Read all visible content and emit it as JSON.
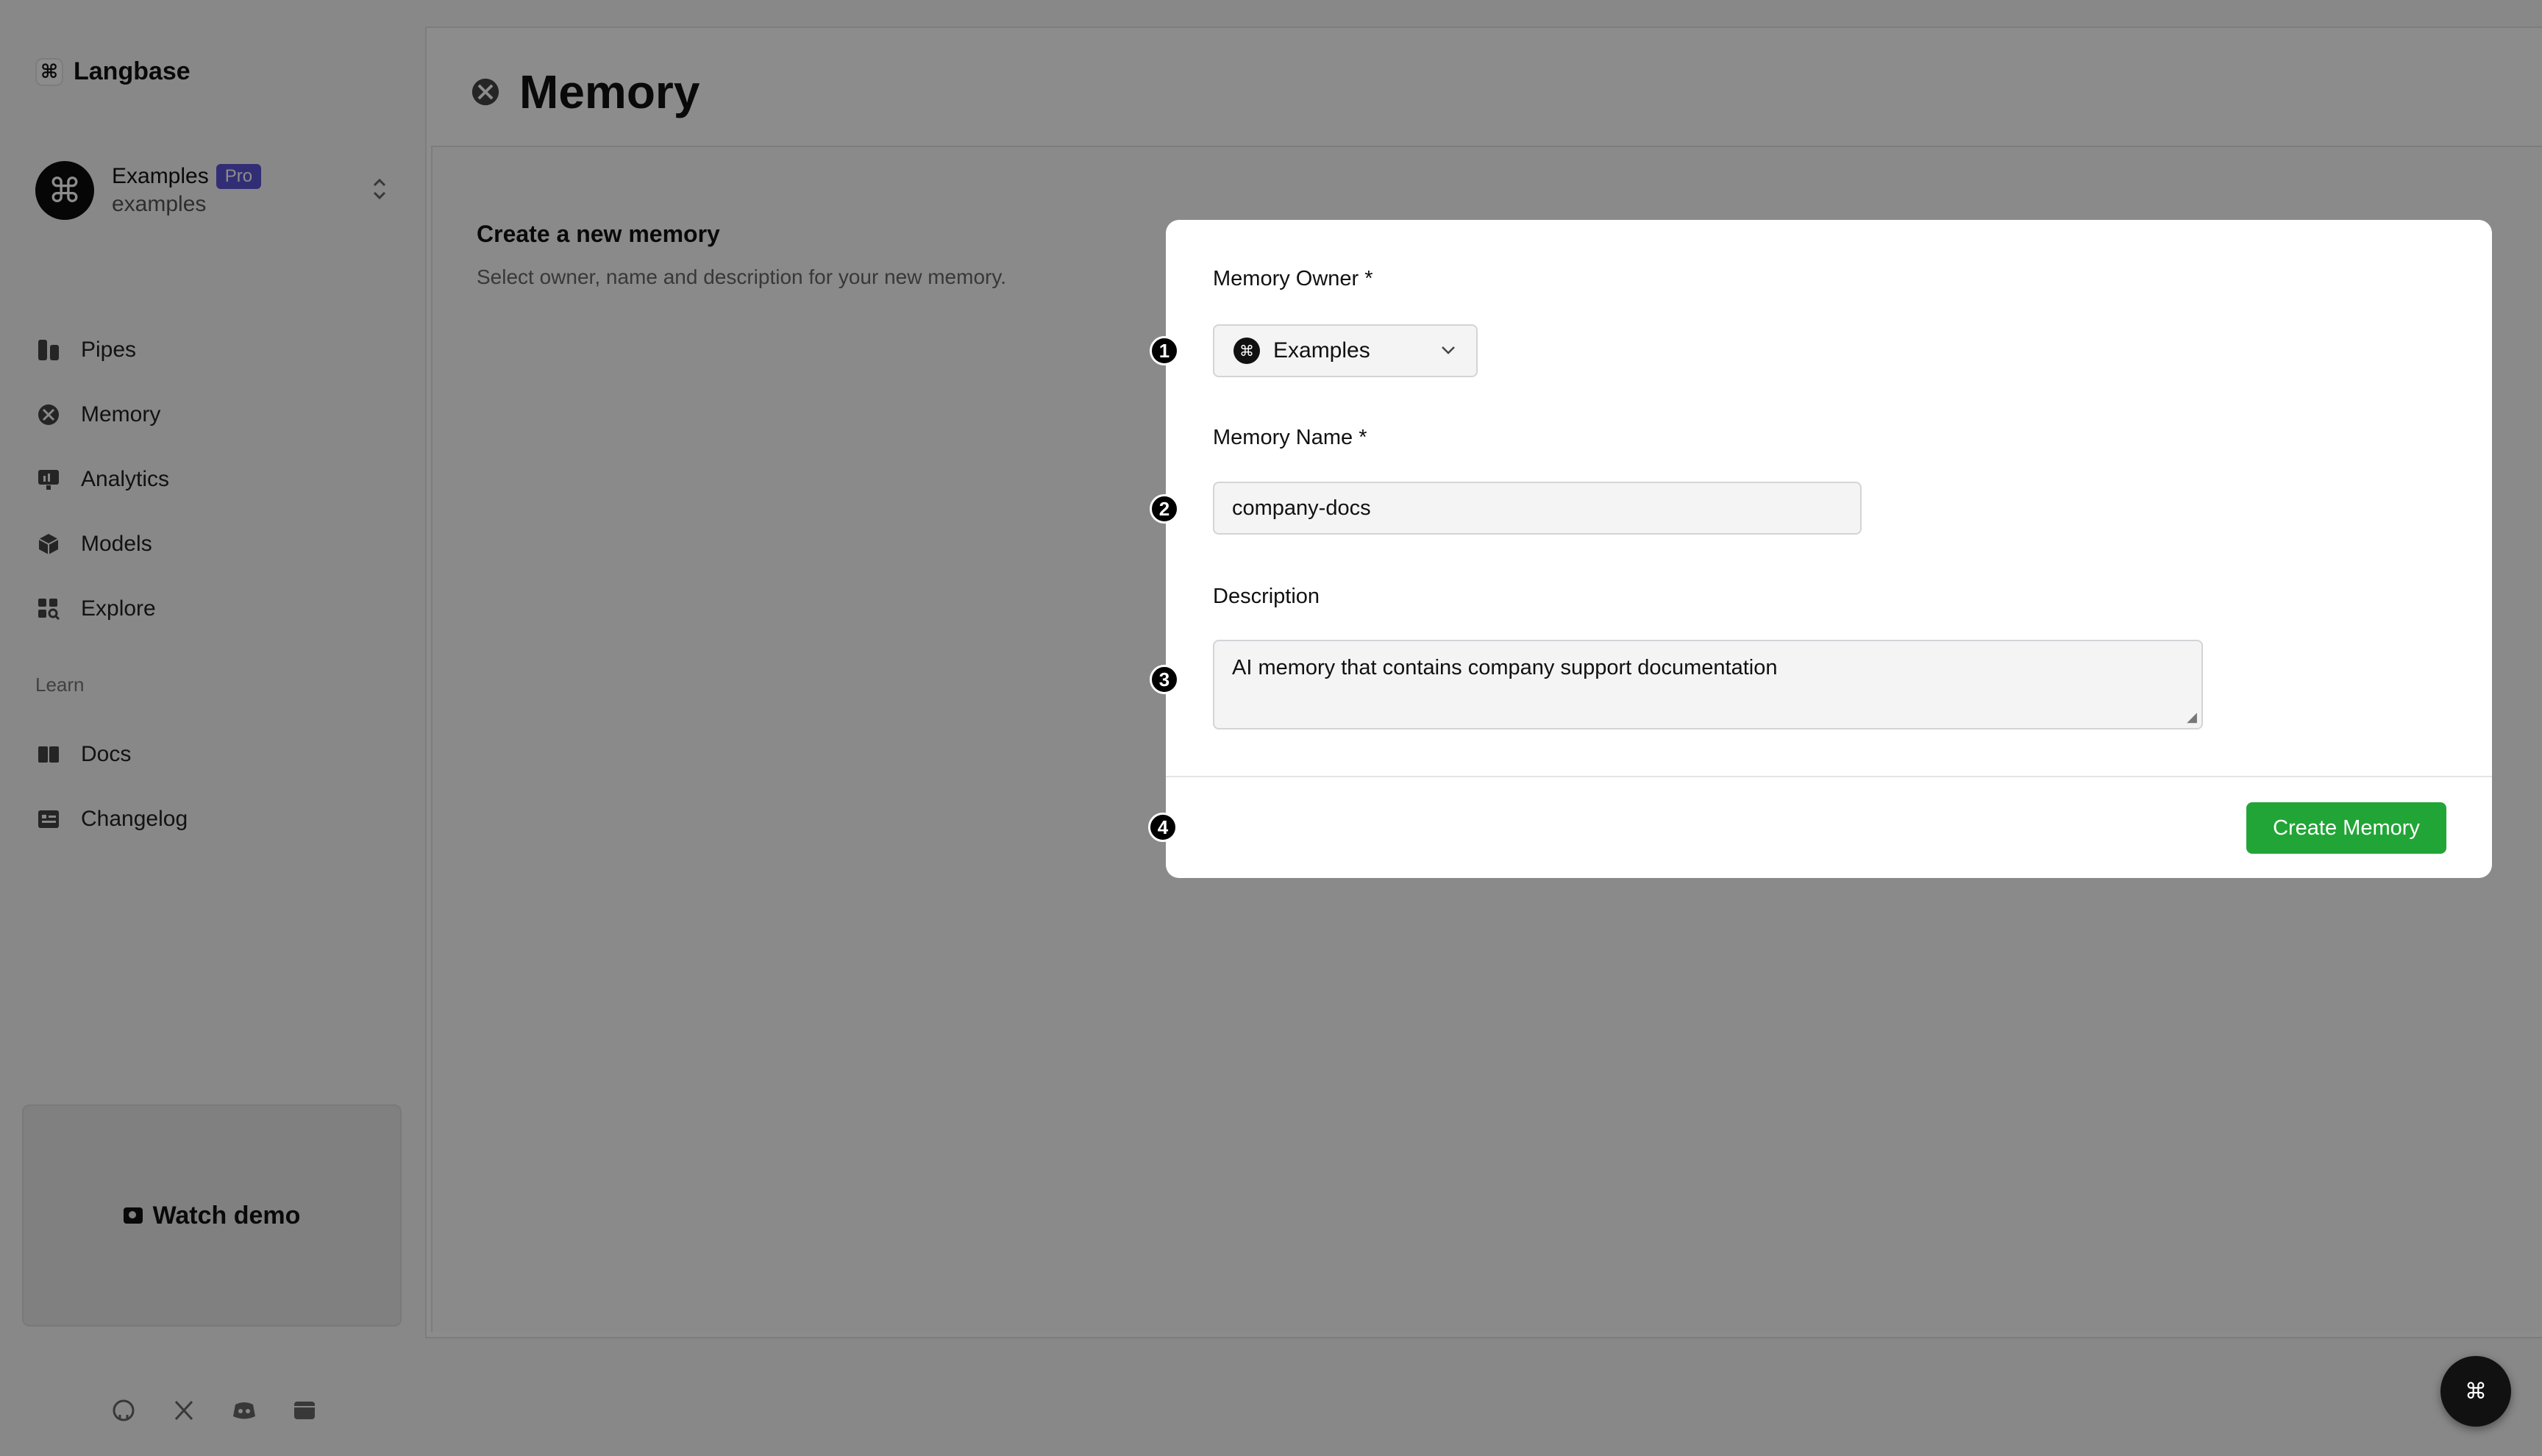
{
  "brand": {
    "logo_glyph": "⌘",
    "name": "Langbase"
  },
  "org": {
    "avatar_glyph": "⌘",
    "name": "Examples",
    "badge": "Pro",
    "slug": "examples"
  },
  "sidebar": {
    "items": [
      {
        "label": "Pipes",
        "icon": "pipes-icon"
      },
      {
        "label": "Memory",
        "icon": "memory-icon"
      },
      {
        "label": "Analytics",
        "icon": "analytics-icon"
      },
      {
        "label": "Models",
        "icon": "models-icon"
      },
      {
        "label": "Explore",
        "icon": "explore-icon"
      }
    ],
    "learn_label": "Learn",
    "learn_items": [
      {
        "label": "Docs",
        "icon": "docs-icon"
      },
      {
        "label": "Changelog",
        "icon": "changelog-icon"
      }
    ],
    "demo_label": "Watch demo"
  },
  "header": {
    "title": "Memory"
  },
  "intro": {
    "title": "Create a new memory",
    "subtitle": "Select owner, name and description for your new memory."
  },
  "form": {
    "owner_label": "Memory Owner *",
    "owner_value": "Examples",
    "owner_glyph": "⌘",
    "name_label": "Memory Name *",
    "name_value": "company-docs",
    "description_label": "Description",
    "description_value": "AI memory that contains company support documentation",
    "submit_label": "Create Memory"
  },
  "steps": [
    "1",
    "2",
    "3",
    "4"
  ],
  "fab_glyph": "⌘",
  "colors": {
    "accent": "#22a537",
    "pro_badge": "#5b54d6"
  }
}
